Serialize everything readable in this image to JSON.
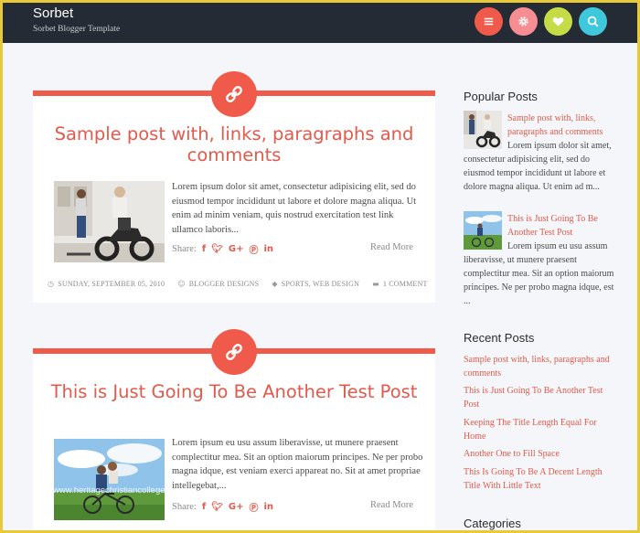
{
  "header": {
    "site_title": "Sorbet",
    "site_description": "Sorbet Blogger Template",
    "buttons": [
      {
        "icon": "menu-icon",
        "color": "#ef5a4a"
      },
      {
        "icon": "gear-icon",
        "color": "#f68d92"
      },
      {
        "icon": "heart-icon",
        "color": "#c6dc46"
      },
      {
        "icon": "search-icon",
        "color": "#3fc8dc"
      }
    ]
  },
  "posts": [
    {
      "title": "Sample post with, links, paragraphs and comments",
      "excerpt": "Lorem ipsum dolor sit amet, consectetur adipisicing elit, sed do eiusmod tempor incididunt ut labore et dolore magna aliqua. Ut enim ad minim veniam, quis nostrud exercitation test link ullamco laboris...",
      "share_label": "Share:",
      "read_more": "Read More",
      "date": "SUNDAY, SEPTEMBER 05, 2010",
      "author": "BLOGGER DESIGNS",
      "labels": "SPORTS, WEB DESIGN",
      "comments": "1 COMMENT"
    },
    {
      "title": "This is Just Going To Be Another Test Post",
      "excerpt": "Lorem ipsum eu usu assum liberavisse, ut munere praesent complectitur mea. Sit an option maiorum principes. Ne per probo magna idque, est veniam exerci appareat no. Sit at amet propriae intellegebat,...",
      "share_label": "Share:",
      "read_more": "Read More"
    }
  ],
  "sidebar": {
    "popular_heading": "Popular Posts",
    "popular": [
      {
        "title": "Sample post with, links, paragraphs and comments",
        "snippet": "Lorem ipsum dolor sit amet, consectetur adipisicing elit, sed do eiusmod tempor incididunt ut labore et dolore magna aliqua. Ut enim ad m..."
      },
      {
        "title": "This is Just Going To Be Another Test Post",
        "snippet": "Lorem ipsum eu usu assum liberavisse, ut munere praesent complectitur mea. Sit an option maiorum principes. Ne per probo magna idque, est ..."
      }
    ],
    "recent_heading": "Recent Posts",
    "recent": [
      "Sample post with, links, paragraphs and comments",
      "This is Just Going To Be Another Test Post",
      "Keeping The Title Length Equal For Home",
      "Another One to Fill Space",
      "This Is Going To Be A Decent Length Title With Little Text"
    ],
    "categories_heading": "Categories"
  },
  "watermark": "www.heritagechristiancollege.com"
}
